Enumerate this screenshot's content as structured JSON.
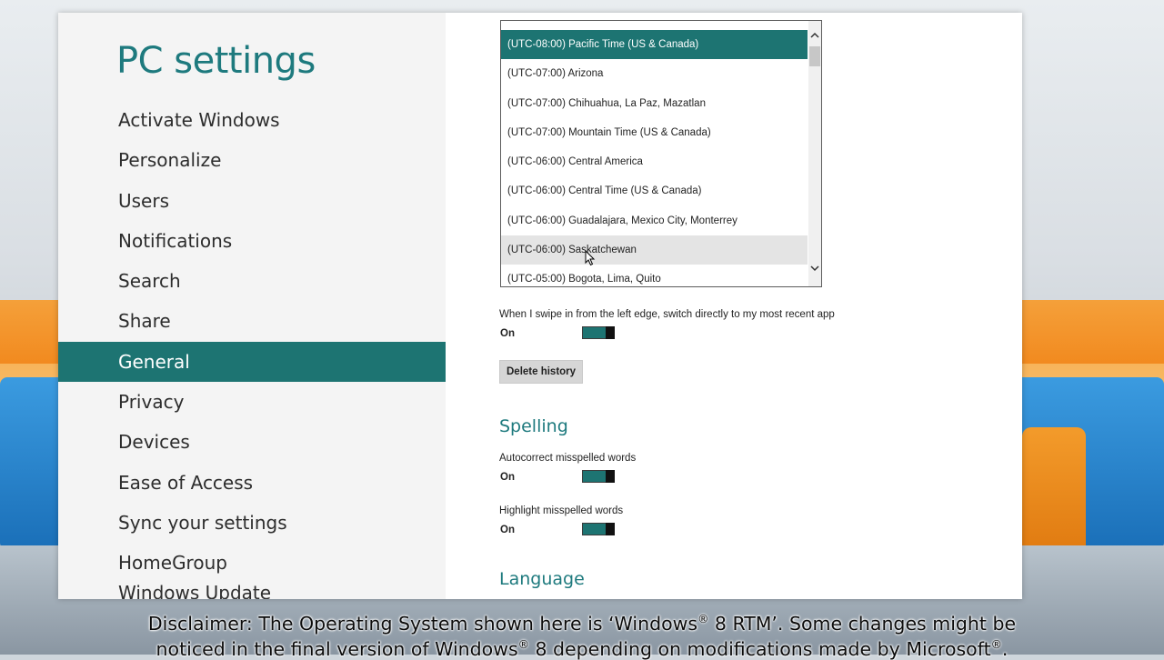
{
  "app_title": "PC settings",
  "nav": [
    {
      "label": "Activate Windows",
      "selected": false
    },
    {
      "label": "Personalize",
      "selected": false
    },
    {
      "label": "Users",
      "selected": false
    },
    {
      "label": "Notifications",
      "selected": false
    },
    {
      "label": "Search",
      "selected": false
    },
    {
      "label": "Share",
      "selected": false
    },
    {
      "label": "General",
      "selected": true
    },
    {
      "label": "Privacy",
      "selected": false
    },
    {
      "label": "Devices",
      "selected": false
    },
    {
      "label": "Ease of Access",
      "selected": false
    },
    {
      "label": "Sync your settings",
      "selected": false
    },
    {
      "label": "HomeGroup",
      "selected": false
    },
    {
      "label": "Windows Update",
      "selected": false
    }
  ],
  "timezone_list": {
    "items": [
      "(UTC-08:00) Pacific Time (US & Canada)",
      "(UTC-07:00) Arizona",
      "(UTC-07:00) Chihuahua, La Paz, Mazatlan",
      "(UTC-07:00) Mountain Time (US & Canada)",
      "(UTC-06:00) Central America",
      "(UTC-06:00) Central Time (US & Canada)",
      "(UTC-06:00) Guadalajara, Mexico City, Monterrey",
      "(UTC-06:00) Saskatchewan",
      "(UTC-05:00) Bogota, Lima, Quito"
    ],
    "selected": "(UTC-08:00) Pacific Time (US & Canada)",
    "hovered": "(UTC-06:00) Saskatchewan"
  },
  "swipe_setting": {
    "label": "When I swipe in from the left edge, switch directly to my most recent app",
    "state": "On"
  },
  "delete_history_label": "Delete history",
  "spelling": {
    "heading": "Spelling",
    "autocorrect": {
      "label": "Autocorrect misspelled words",
      "state": "On"
    },
    "highlight": {
      "label": "Highlight misspelled words",
      "state": "On"
    }
  },
  "language_heading": "Language",
  "disclaimer": {
    "line1_a": "Disclaimer: The Operating System shown here is ‘Windows",
    "line1_b": " 8 RTM’. Some changes might be",
    "line2_a": "noticed in the final version of Windows",
    "line2_b": " 8 depending on modifications made by Microsoft",
    "line2_c": ".",
    "reg": "®"
  },
  "colors": {
    "accent": "#1d7472",
    "title": "#1e7a7e"
  },
  "icons": {
    "scroll_up": "chevron-up-icon",
    "scroll_down": "chevron-down-icon",
    "pointer": "mouse-pointer-icon"
  }
}
